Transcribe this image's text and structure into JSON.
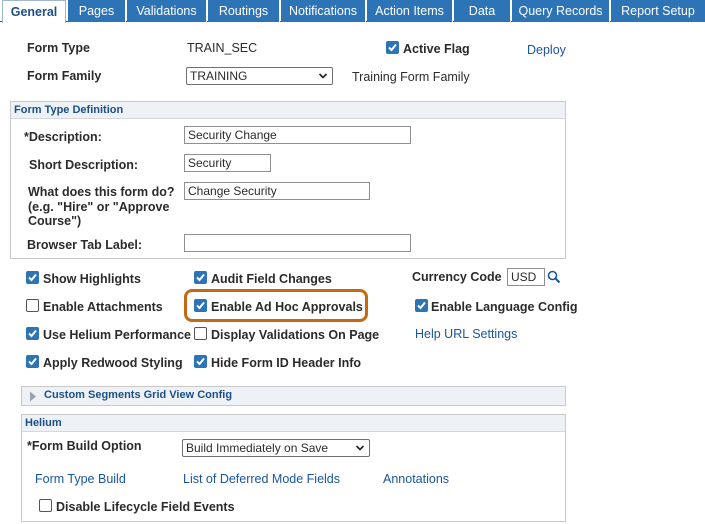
{
  "tabs": [
    {
      "label": "General",
      "active": true
    },
    {
      "label": "Pages"
    },
    {
      "label": "Validations"
    },
    {
      "label": "Routings"
    },
    {
      "label": "Notifications"
    },
    {
      "label": "Action Items"
    },
    {
      "label": "Data"
    },
    {
      "label": "Query Records"
    },
    {
      "label": "Report Setup"
    }
  ],
  "header": {
    "form_type_label": "Form Type",
    "form_type_value": "TRAIN_SEC",
    "active_flag_label": "Active Flag",
    "active_flag_checked": true,
    "deploy_link": "Deploy",
    "form_family_label": "Form Family",
    "form_family_value": "TRAINING",
    "form_family_desc": "Training Form Family"
  },
  "definition": {
    "title": "Form Type Definition",
    "description_label": "*Description:",
    "description_value": "Security Change",
    "short_description_label": "Short Description:",
    "short_description_value": "Security",
    "what_label_1": "What does this form do?",
    "what_label_2": "(e.g. \"Hire\" or \"Approve",
    "what_label_3": "Course\")",
    "what_value": "Change Security",
    "browser_tab_label": "Browser Tab Label:",
    "browser_tab_value": ""
  },
  "options": {
    "show_highlights": "Show Highlights",
    "audit_field_changes": "Audit Field Changes",
    "currency_code_label": "Currency Code",
    "currency_code_value": "USD",
    "enable_attachments": "Enable Attachments",
    "enable_ad_hoc_approvals": "Enable Ad Hoc Approvals",
    "enable_language_config": "Enable Language Config",
    "use_helium_performance": "Use Helium Performance",
    "display_validations": "Display Validations On Page",
    "help_url_settings": "Help URL Settings",
    "apply_redwood_styling": "Apply Redwood Styling",
    "hide_form_id_header": "Hide Form ID Header Info"
  },
  "custom_segments": {
    "title": "Custom Segments Grid View Config"
  },
  "helium": {
    "title": "Helium",
    "form_build_label": "*Form Build Option",
    "form_build_value": "Build Immediately on Save",
    "form_type_build_link": "Form Type Build",
    "deferred_fields_link": "List of Deferred Mode Fields",
    "annotations_link": "Annotations",
    "disable_lifecycle": "Disable Lifecycle Field Events"
  },
  "colors": {
    "tab_blue": "#2d74b6",
    "link_blue": "#1a56a0",
    "highlight_orange": "#c56a12"
  }
}
